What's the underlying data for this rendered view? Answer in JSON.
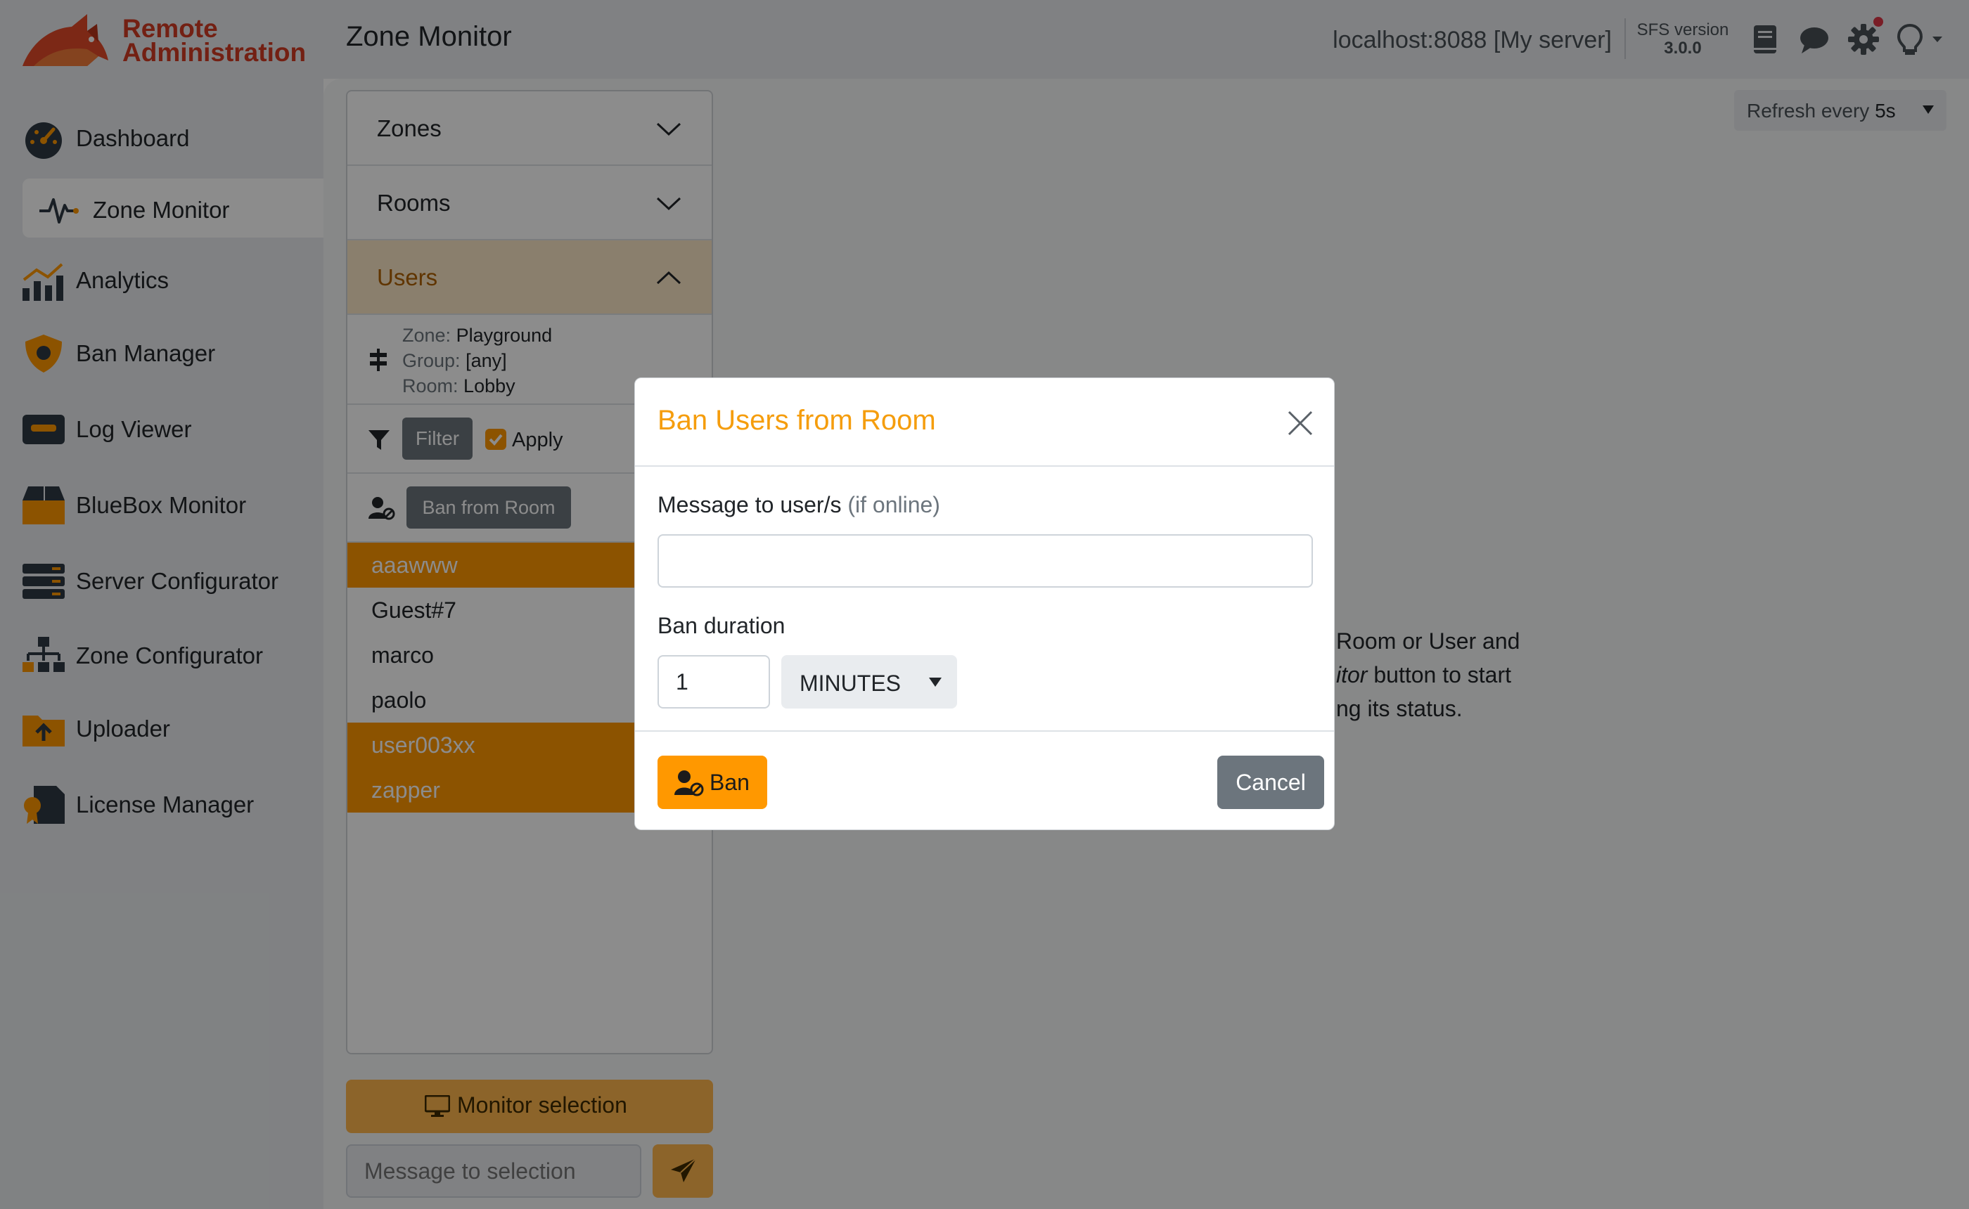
{
  "app": {
    "logo_line1": "Remote",
    "logo_line2": "Administration",
    "page_title": "Zone Monitor",
    "server_label": "localhost:8088 [My server]",
    "sfs_version_label": "SFS version",
    "sfs_version": "3.0.0",
    "header_icons": [
      "book-icon",
      "chat-icon",
      "gear-icon",
      "lightbulb-icon"
    ]
  },
  "sidebar": {
    "items": [
      {
        "label": "Dashboard",
        "icon": "gauge-icon"
      },
      {
        "label": "Zone Monitor",
        "icon": "pulse-icon",
        "active": true
      },
      {
        "label": "Analytics",
        "icon": "bar-chart-icon"
      },
      {
        "label": "Ban Manager",
        "icon": "shield-icon"
      },
      {
        "label": "Log Viewer",
        "icon": "log-icon"
      },
      {
        "label": "BlueBox Monitor",
        "icon": "box-icon"
      },
      {
        "label": "Server Configurator",
        "icon": "server-icon"
      },
      {
        "label": "Zone Configurator",
        "icon": "hierarchy-icon"
      },
      {
        "label": "Uploader",
        "icon": "upload-folder-icon"
      },
      {
        "label": "License Manager",
        "icon": "certificate-icon"
      }
    ]
  },
  "panel": {
    "accordions": [
      {
        "label": "Zones",
        "expanded": false
      },
      {
        "label": "Rooms",
        "expanded": false
      },
      {
        "label": "Users",
        "expanded": true
      }
    ],
    "info": {
      "zone_key": "Zone:",
      "zone_val": "Playground",
      "group_key": "Group:",
      "group_val": "[any]",
      "room_key": "Room:",
      "room_val": "Lobby"
    },
    "filter_label": "Filter",
    "apply_label": "Apply",
    "apply_checked": true,
    "ban_from_room_label": "Ban from Room",
    "users": [
      {
        "name": "aaawww",
        "selected": true
      },
      {
        "name": "Guest#7",
        "selected": false
      },
      {
        "name": "marco",
        "selected": false
      },
      {
        "name": "paolo",
        "selected": false
      },
      {
        "name": "user003xx",
        "selected": true
      },
      {
        "name": "zapper",
        "selected": true
      }
    ],
    "monitor_selection_label": "Monitor selection",
    "message_placeholder": "Message to selection"
  },
  "content": {
    "refresh_prefix": "Refresh every",
    "refresh_value": "5s",
    "hint_line1": "Room or User and",
    "hint_line2_italic": "itor",
    "hint_line2_rest": " button to start",
    "hint_line3": "ng its status."
  },
  "modal": {
    "title": "Ban Users from Room",
    "message_label": "Message to user/s",
    "message_hint": "(if online)",
    "message_value": "",
    "duration_label": "Ban duration",
    "duration_value": "1",
    "duration_unit": "MINUTES",
    "ban_label": "Ban",
    "cancel_label": "Cancel"
  },
  "colors": {
    "accent": "#ff9800",
    "modal_title": "#f59d0d",
    "logo": "#d13b24",
    "secondary": "#6c757d"
  }
}
